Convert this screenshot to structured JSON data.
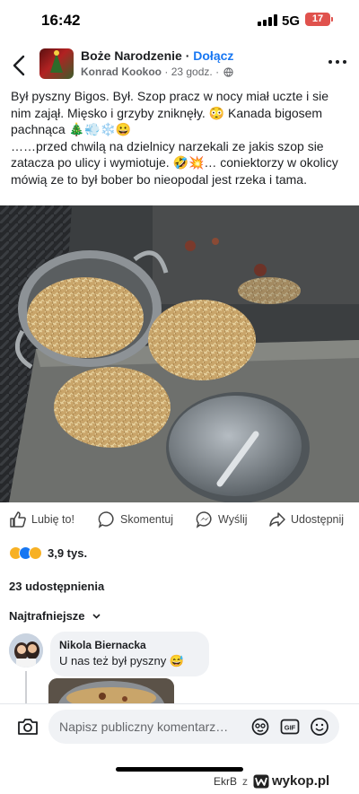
{
  "status_bar": {
    "time": "16:42",
    "network": "5G",
    "battery_level": "17",
    "battery_color": "#e0524d"
  },
  "post": {
    "group_name": "Boże Narodzenie",
    "separator": "·",
    "join_label": "Dołącz",
    "author": "Konrad Kookoo",
    "time": "23 godz.",
    "audience_icon": "globe-icon",
    "text_line1": "Był pyszny Bigos. Był. Szop pracz w nocy miał uczte i sie nim zajął. Mięsko i grzyby zniknęły. 😳 Kanada bigosem pachnąca 🎄💨❄️😀",
    "text_line2": "……przed chwilą na dzielnicy narzekali ze jakis szop sie zatacza po ulicy i wymiotuje. 🤣💥… coniektorzy w okolicy mówią ze to był bober bo nieopodal jest rzeka i tama."
  },
  "actions": {
    "like": "Lubię to!",
    "comment": "Skomentuj",
    "send": "Wyślij",
    "share": "Udostępnij"
  },
  "reactions": {
    "icons": [
      "haha",
      "like",
      "wow"
    ],
    "count": "3,9 tys."
  },
  "shares": {
    "text": "23 udostępnienia"
  },
  "comments_section": {
    "sort_label": "Najtrafniejsze",
    "comments": [
      {
        "name": "Nikola Biernacka",
        "text": "U nas też był pyszny 😅"
      }
    ]
  },
  "composer": {
    "placeholder": "Napisz publiczny komentarz…",
    "gif_label": "GIF"
  },
  "watermark": {
    "author": "EkrB",
    "separator": "z",
    "brand": "wykop.pl"
  },
  "colors": {
    "accent": "#1877f2",
    "text": "#1c1e21",
    "muted": "#65676b",
    "bubble": "#f0f2f5"
  }
}
